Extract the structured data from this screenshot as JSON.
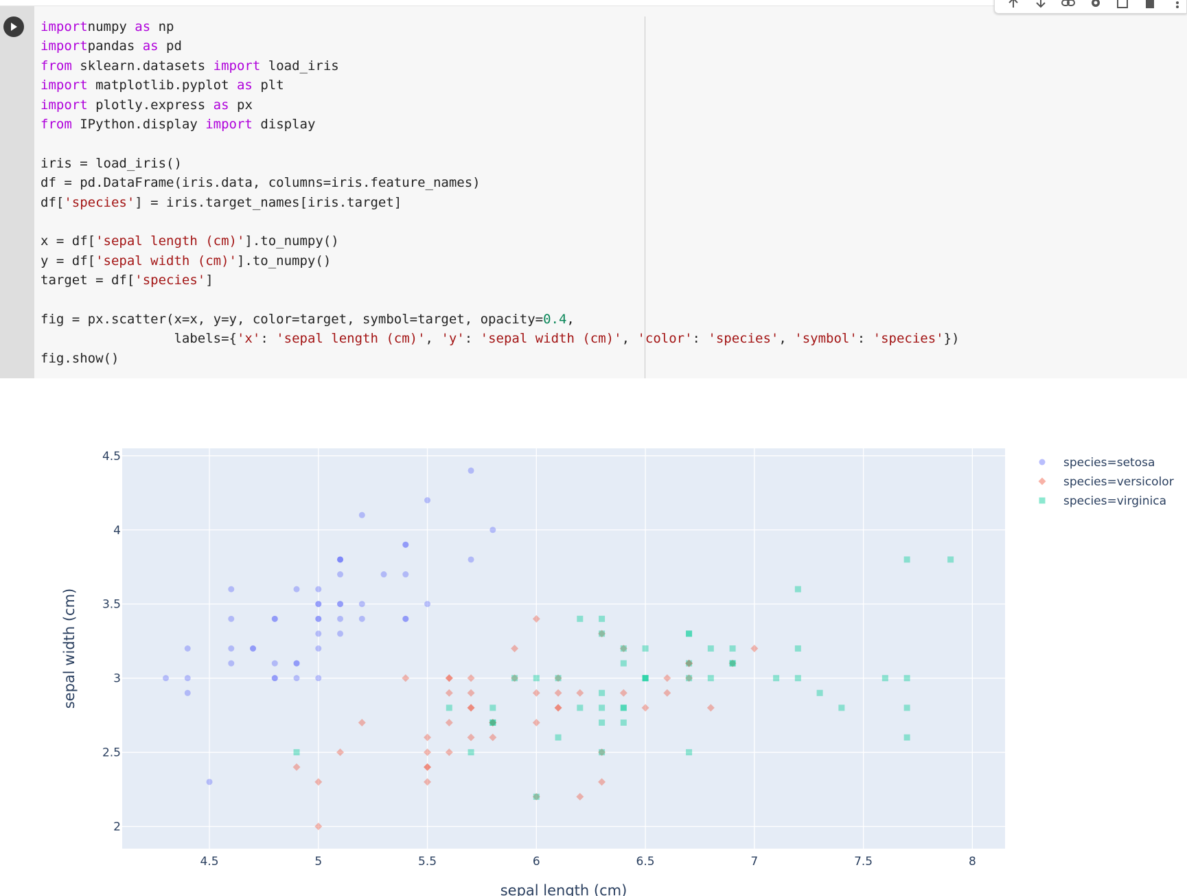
{
  "notebook": {
    "code_lines": [
      [
        [
          "kw",
          "import"
        ],
        [
          "",
          "numpy "
        ],
        [
          "kw",
          "as"
        ],
        [
          "",
          " np"
        ]
      ],
      [
        [
          "kw",
          "import"
        ],
        [
          "",
          "pandas "
        ],
        [
          "kw",
          "as"
        ],
        [
          "",
          " pd"
        ]
      ],
      [
        [
          "kw",
          "from"
        ],
        [
          "",
          " sklearn.datasets "
        ],
        [
          "kw",
          "import"
        ],
        [
          "",
          " load_iris"
        ]
      ],
      [
        [
          "kw",
          "import"
        ],
        [
          "",
          " matplotlib.pyplot "
        ],
        [
          "kw",
          "as"
        ],
        [
          "",
          " plt"
        ]
      ],
      [
        [
          "kw",
          "import"
        ],
        [
          "",
          " plotly.express "
        ],
        [
          "kw",
          "as"
        ],
        [
          "",
          " px"
        ]
      ],
      [
        [
          "kw",
          "from"
        ],
        [
          "",
          " IPython.display "
        ],
        [
          "kw",
          "import"
        ],
        [
          "",
          " display"
        ]
      ],
      [],
      [
        [
          "",
          "iris = load_iris()"
        ]
      ],
      [
        [
          "",
          "df = pd.DataFrame(iris.data, columns=iris.feature_names)"
        ]
      ],
      [
        [
          "",
          "df["
        ],
        [
          "st",
          "'species'"
        ],
        [
          "",
          "] = iris.target_names[iris.target]"
        ]
      ],
      [],
      [
        [
          "",
          "x = df["
        ],
        [
          "st",
          "'sepal length (cm)'"
        ],
        [
          "",
          "].to_numpy()"
        ]
      ],
      [
        [
          "",
          "y = df["
        ],
        [
          "st",
          "'sepal width (cm)'"
        ],
        [
          "",
          "].to_numpy()"
        ]
      ],
      [
        [
          "",
          "target = df["
        ],
        [
          "st",
          "'species'"
        ],
        [
          "",
          "]"
        ]
      ],
      [],
      [
        [
          "",
          "fig = px.scatter(x=x, y=y, color=target, symbol=target, opacity="
        ],
        [
          "nm",
          "0.4"
        ],
        [
          "",
          ","
        ]
      ],
      [
        [
          "",
          "                 labels={"
        ],
        [
          "st",
          "'x'"
        ],
        [
          "",
          ": "
        ],
        [
          "st",
          "'sepal length (cm)'"
        ],
        [
          "",
          ", "
        ],
        [
          "st",
          "'y'"
        ],
        [
          "",
          ": "
        ],
        [
          "st",
          "'sepal width (cm)'"
        ],
        [
          "",
          ", "
        ],
        [
          "st",
          "'color'"
        ],
        [
          "",
          ": "
        ],
        [
          "st",
          "'species'"
        ],
        [
          "",
          ", "
        ],
        [
          "st",
          "'symbol'"
        ],
        [
          "",
          ": "
        ],
        [
          "st",
          "'species'"
        ],
        [
          "",
          "})"
        ]
      ],
      [
        [
          "",
          "fig.show()"
        ]
      ]
    ],
    "toolbar_icons": [
      "arrow-up-icon",
      "arrow-down-icon",
      "link-icon",
      "gear-icon",
      "mirror-cell-icon",
      "trash-icon",
      "more-icon"
    ]
  },
  "chart_data": {
    "type": "scatter",
    "xlabel": "sepal length (cm)",
    "ylabel": "sepal width (cm)",
    "xlim": [
      4.1,
      8.15
    ],
    "ylim": [
      1.85,
      4.55
    ],
    "xticks": [
      4.5,
      5,
      5.5,
      6,
      6.5,
      7,
      7.5,
      8
    ],
    "yticks": [
      2,
      2.5,
      3,
      3.5,
      4,
      4.5
    ],
    "xtick_labels": [
      "4.5",
      "5",
      "5.5",
      "6",
      "6.5",
      "7",
      "7.5",
      "8"
    ],
    "ytick_labels": [
      "2",
      "2.5",
      "3",
      "3.5",
      "4",
      "4.5"
    ],
    "opacity": 0.4,
    "grid": true,
    "legend_position": "top-right",
    "series": [
      {
        "name": "species=setosa",
        "color": "#636efa",
        "symbol": "circle",
        "x": [
          5.1,
          4.9,
          4.7,
          4.6,
          5.0,
          5.4,
          4.6,
          5.0,
          4.4,
          4.9,
          5.4,
          4.8,
          4.8,
          4.3,
          5.8,
          5.7,
          5.4,
          5.1,
          5.7,
          5.1,
          5.4,
          5.1,
          4.6,
          5.1,
          4.8,
          5.0,
          5.0,
          5.2,
          5.2,
          4.7,
          4.8,
          5.4,
          5.2,
          5.5,
          4.9,
          5.0,
          5.5,
          4.9,
          4.4,
          5.1,
          5.0,
          4.5,
          4.4,
          5.0,
          5.1,
          4.8,
          5.1,
          4.6,
          5.3,
          5.0
        ],
        "y": [
          3.5,
          3.0,
          3.2,
          3.1,
          3.6,
          3.9,
          3.4,
          3.4,
          2.9,
          3.1,
          3.7,
          3.4,
          3.0,
          3.0,
          4.0,
          4.4,
          3.9,
          3.5,
          3.8,
          3.8,
          3.4,
          3.7,
          3.6,
          3.3,
          3.4,
          3.0,
          3.4,
          3.5,
          3.4,
          3.2,
          3.1,
          3.4,
          4.1,
          4.2,
          3.1,
          3.2,
          3.5,
          3.6,
          3.0,
          3.4,
          3.5,
          2.3,
          3.2,
          3.5,
          3.8,
          3.0,
          3.8,
          3.2,
          3.7,
          3.3
        ]
      },
      {
        "name": "species=versicolor",
        "color": "#ef553b",
        "symbol": "diamond",
        "x": [
          7.0,
          6.4,
          6.9,
          5.5,
          6.5,
          5.7,
          6.3,
          4.9,
          6.6,
          5.2,
          5.0,
          5.9,
          6.0,
          6.1,
          5.6,
          6.7,
          5.6,
          5.8,
          6.2,
          5.6,
          5.9,
          6.1,
          6.3,
          6.1,
          6.4,
          6.6,
          6.8,
          6.7,
          6.0,
          5.7,
          5.5,
          5.5,
          5.8,
          6.0,
          5.4,
          6.0,
          6.7,
          6.3,
          5.6,
          5.5,
          5.5,
          6.1,
          5.8,
          5.0,
          5.6,
          5.7,
          5.7,
          6.2,
          5.1,
          5.7
        ],
        "y": [
          3.2,
          3.2,
          3.1,
          2.3,
          2.8,
          2.8,
          3.3,
          2.4,
          2.9,
          2.7,
          2.0,
          3.0,
          2.2,
          2.9,
          2.9,
          3.1,
          3.0,
          2.7,
          2.2,
          2.5,
          3.2,
          2.8,
          2.5,
          2.8,
          2.9,
          3.0,
          2.8,
          3.0,
          2.9,
          2.6,
          2.4,
          2.4,
          2.7,
          2.7,
          3.0,
          3.4,
          3.1,
          2.3,
          3.0,
          2.5,
          2.6,
          3.0,
          2.6,
          2.3,
          2.7,
          3.0,
          2.9,
          2.9,
          2.5,
          2.8
        ]
      },
      {
        "name": "species=virginica",
        "color": "#00cc96",
        "symbol": "square",
        "x": [
          6.3,
          5.8,
          7.1,
          6.3,
          6.5,
          7.6,
          4.9,
          7.3,
          6.7,
          7.2,
          6.5,
          6.4,
          6.8,
          5.7,
          5.8,
          6.4,
          6.5,
          7.7,
          7.7,
          6.0,
          6.9,
          5.6,
          7.7,
          6.3,
          6.7,
          7.2,
          6.2,
          6.1,
          6.4,
          7.2,
          7.4,
          7.9,
          6.4,
          6.3,
          6.1,
          7.7,
          6.3,
          6.4,
          6.0,
          6.9,
          6.7,
          6.9,
          5.8,
          6.8,
          6.7,
          6.7,
          6.3,
          6.5,
          6.2,
          5.9
        ],
        "y": [
          3.3,
          2.7,
          3.0,
          2.9,
          3.0,
          3.0,
          2.5,
          2.9,
          2.5,
          3.6,
          3.2,
          2.7,
          3.0,
          2.5,
          2.8,
          3.2,
          3.0,
          3.8,
          2.6,
          2.2,
          3.2,
          2.8,
          2.8,
          2.7,
          3.3,
          3.2,
          2.8,
          3.0,
          2.8,
          3.0,
          2.8,
          3.8,
          2.8,
          2.8,
          2.6,
          3.0,
          3.4,
          3.1,
          3.0,
          3.1,
          3.1,
          3.1,
          2.7,
          3.2,
          3.3,
          3.0,
          2.5,
          3.0,
          3.4,
          3.0
        ]
      }
    ]
  }
}
